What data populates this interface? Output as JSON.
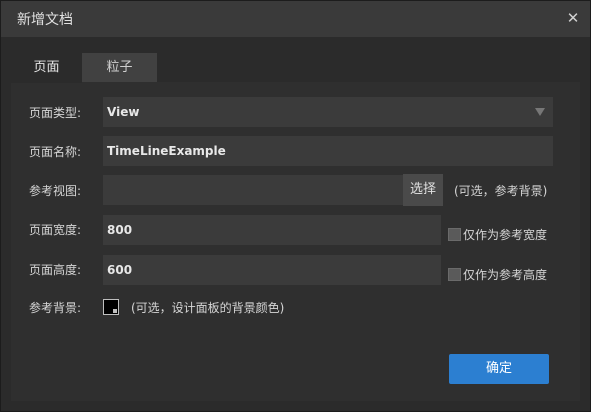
{
  "window": {
    "title": "新增文档",
    "close_glyph": "✕"
  },
  "tabs": [
    {
      "label": "页面",
      "active": true
    },
    {
      "label": "粒子",
      "active": false
    }
  ],
  "form": {
    "page_type": {
      "label": "页面类型:",
      "value": "View"
    },
    "page_name": {
      "label": "页面名称:",
      "value": "TimeLineExample"
    },
    "ref_view": {
      "label": "参考视图:",
      "value": "",
      "button": "选择",
      "hint": "(可选，参考背景)"
    },
    "page_width": {
      "label": "页面宽度:",
      "value": "800",
      "checkbox_label": "仅作为参考宽度"
    },
    "page_height": {
      "label": "页面高度:",
      "value": "600",
      "checkbox_label": "仅作为参考高度"
    },
    "ref_bg": {
      "label": "参考背景:",
      "color": "#000000",
      "hint": "(可选，设计面板的背景颜色)"
    }
  },
  "footer": {
    "ok_label": "确定"
  },
  "colors": {
    "accent": "#2c7fd1"
  }
}
